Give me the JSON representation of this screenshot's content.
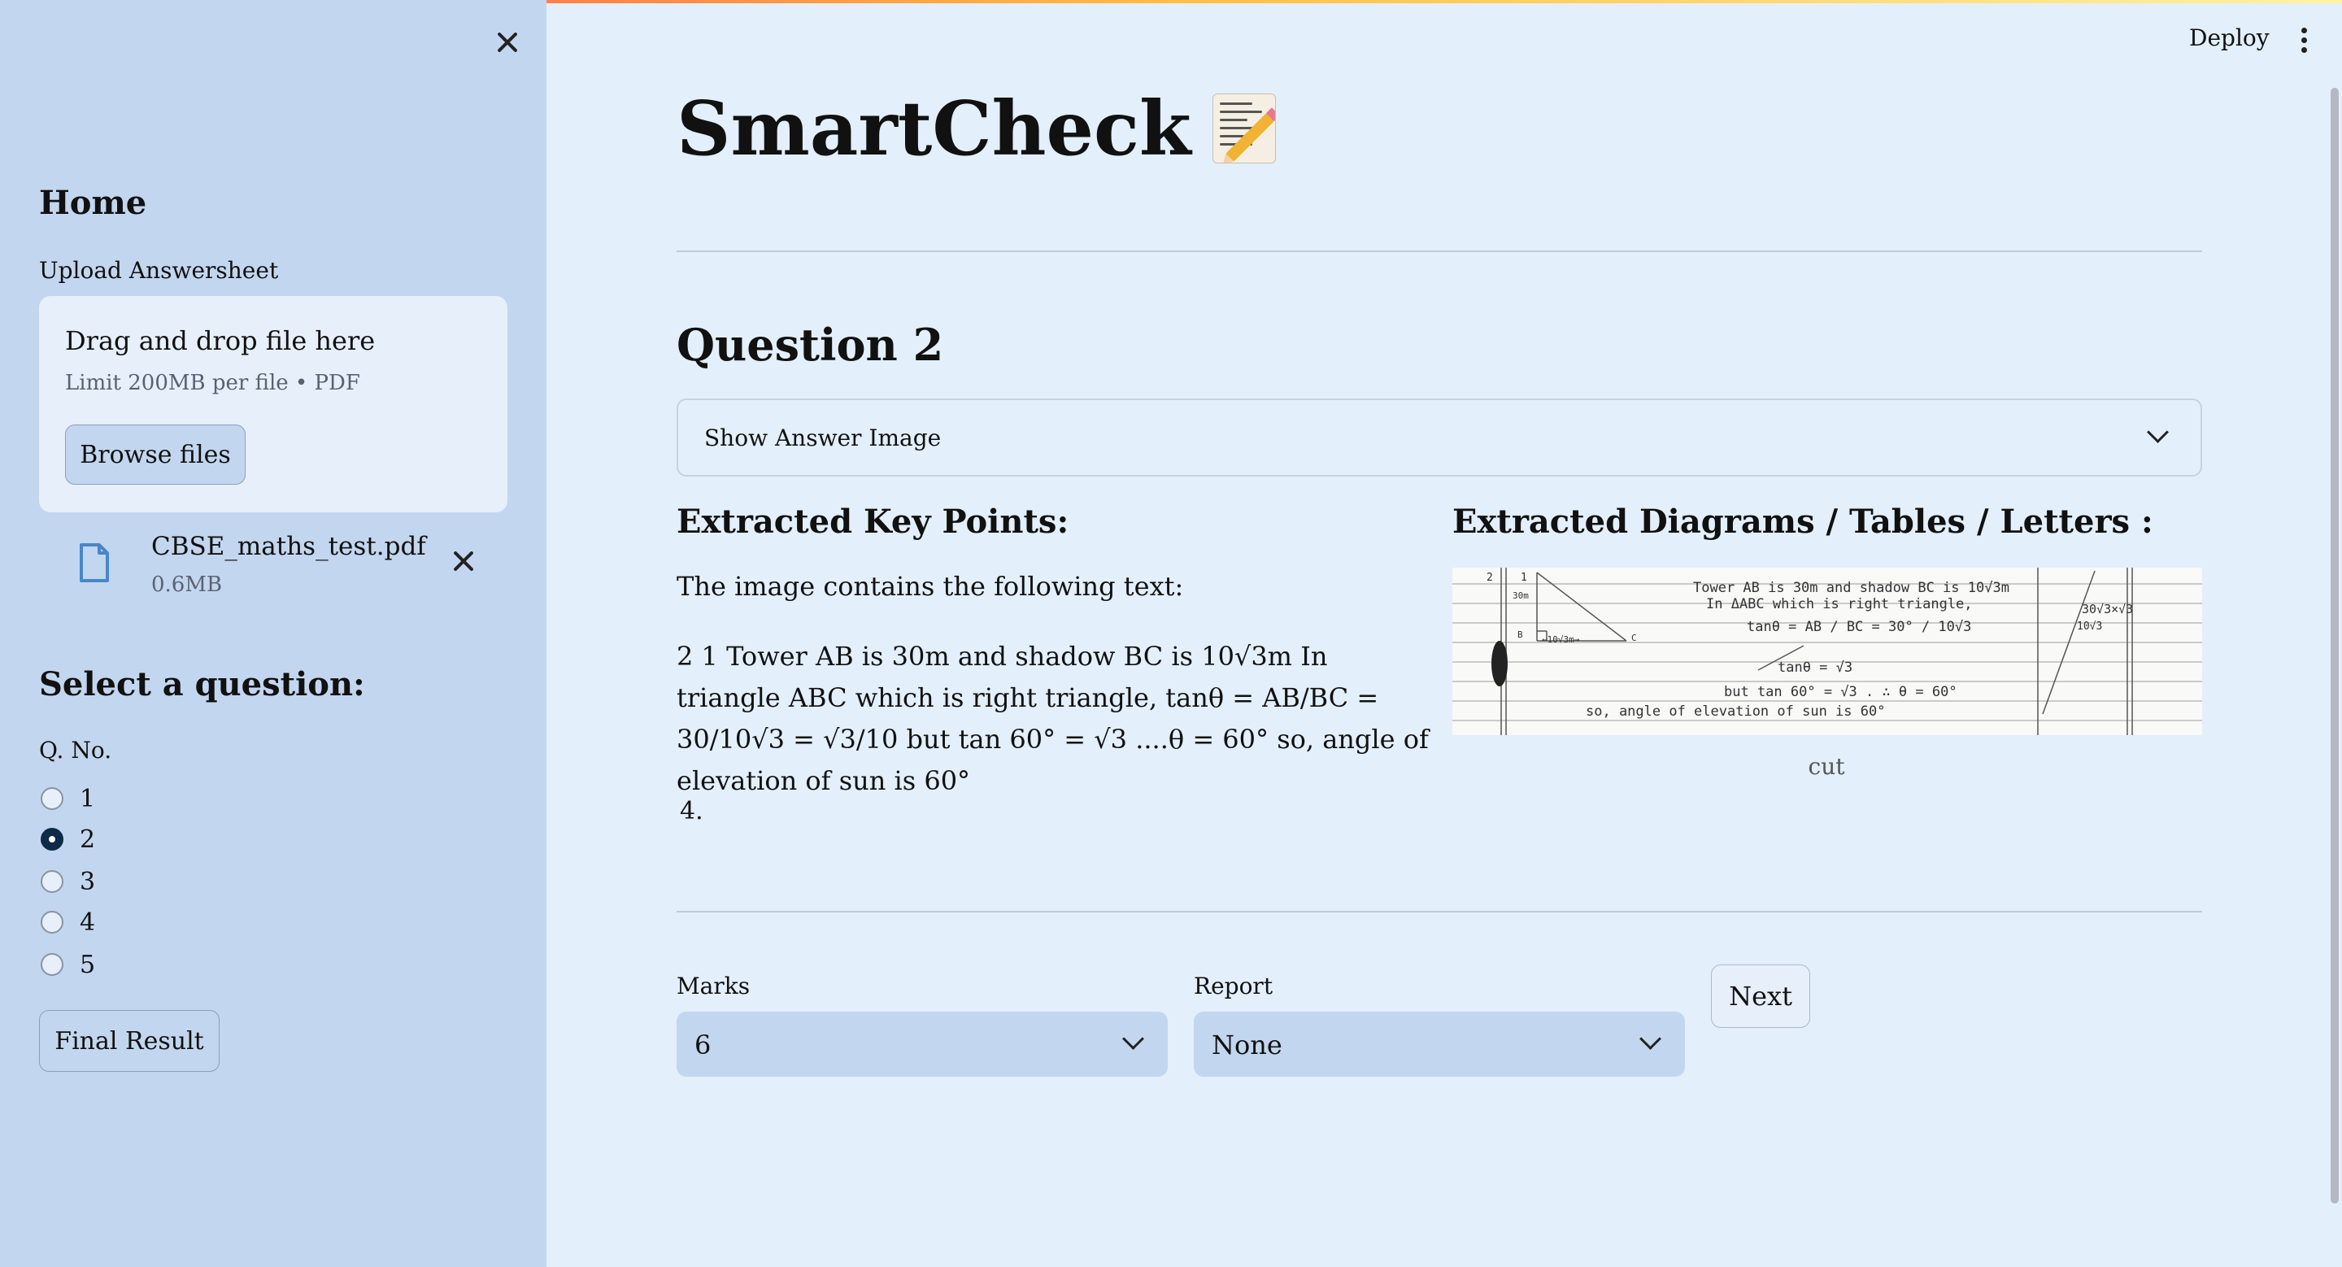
{
  "sidebar": {
    "home_title": "Home",
    "upload_label": "Upload Answersheet",
    "dropzone": {
      "title": "Drag and drop file here",
      "subtitle": "Limit 200MB per file • PDF",
      "browse_label": "Browse files"
    },
    "uploaded_file": {
      "name": "CBSE_maths_test.pdf",
      "size": "0.6MB"
    },
    "select_title": "Select a question:",
    "qno_label": "Q. No.",
    "questions": [
      "1",
      "2",
      "3",
      "4",
      "5"
    ],
    "selected_question": "2",
    "final_result_label": "Final Result"
  },
  "header": {
    "deploy_label": "Deploy"
  },
  "main": {
    "app_title": "SmartCheck",
    "title_icon": "memo-icon",
    "question_title": "Question 2",
    "expander_label": "Show Answer Image",
    "key_points": {
      "title": "Extracted Key Points:",
      "intro": "The image contains the following text:",
      "body": "2 1 Tower AB is 30m and shadow BC is 10√3m In triangle ABC which is right triangle, tanθ = AB/BC = 30/10√3 = √3/10 but tan 60° = √3 ....θ = 60° so, angle of elevation of sun is 60°",
      "list_item": "4."
    },
    "diagrams": {
      "title": "Extracted Diagrams / Tables / Letters :",
      "caption": "cut",
      "handwriting": {
        "line1": "Tower AB is 30m and shadow BC is 10√3m",
        "line2": "In ΔABC which is right triangle,",
        "line3": "tanθ = AB / BC = 30° / 10√3",
        "line4": "tanθ = √3",
        "line5": "but tan 60° = √3 . ∴ θ = 60°",
        "line6": "so, angle of elevation of sun is 60°",
        "side_note": "30√3×√3",
        "side_note2": "10√3",
        "label_2": "2",
        "label_1": "1",
        "label_30m": "30m",
        "label_base": "←10√3m→",
        "label_b": "B",
        "label_c": "C"
      }
    },
    "marks": {
      "label": "Marks",
      "value": "6"
    },
    "report": {
      "label": "Report",
      "value": "None"
    },
    "next_label": "Next"
  },
  "colors": {
    "sidebar_bg": "#c3d6ef",
    "main_bg": "#e3effb",
    "radio_selected": "#0e2a47",
    "file_icon": "#4a86c8"
  }
}
